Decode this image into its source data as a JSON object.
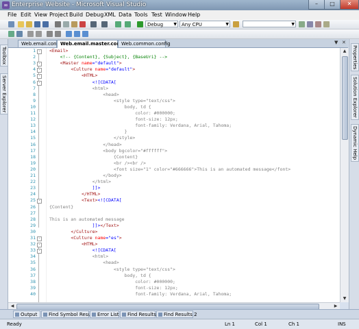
{
  "window": {
    "title": "Enterprise Website - Microsoft Visual Studio",
    "min": "–",
    "max": "□",
    "close": "✕"
  },
  "menu": [
    "File",
    "Edit",
    "View",
    "Project",
    "Build",
    "Debug",
    "XML",
    "Data",
    "Tools",
    "Test",
    "Window",
    "Help"
  ],
  "toolbar": {
    "config": "Debug",
    "platform": "Any CPU"
  },
  "side_left": [
    "Toolbox",
    "Server Explorer"
  ],
  "side_right": [
    "Properties",
    "Solution Explorer",
    "Dynamic Help"
  ],
  "tabs": [
    {
      "label": "Web.email.config",
      "active": false
    },
    {
      "label": "Web.email.master.config",
      "active": true
    },
    {
      "label": "Web.common.config",
      "active": false
    }
  ],
  "tab_controls": {
    "list": "▼",
    "close": "✕"
  },
  "code_lines": [
    {
      "n": "1",
      "fold": "-",
      "t": [
        [
          "tag",
          "<Email>"
        ]
      ]
    },
    {
      "n": "2",
      "t": [
        [
          "txt",
          "    "
        ],
        [
          "com",
          "<!-- {Content}, {Subject}, {BaseUri} -->"
        ]
      ]
    },
    {
      "n": "3",
      "fold": "-",
      "t": [
        [
          "txt",
          "    "
        ],
        [
          "tag",
          "<Master "
        ],
        [
          "att",
          "name"
        ],
        [
          "sym",
          "="
        ],
        [
          "val",
          "\"default\""
        ],
        [
          "tag",
          ">"
        ]
      ]
    },
    {
      "n": "4",
      "fold": "-",
      "t": [
        [
          "txt",
          "        "
        ],
        [
          "tag",
          "<Culture "
        ],
        [
          "att",
          "name"
        ],
        [
          "sym",
          "="
        ],
        [
          "val",
          "\"default\""
        ],
        [
          "tag",
          ">"
        ]
      ]
    },
    {
      "n": "5",
      "fold": "-",
      "t": [
        [
          "txt",
          "            "
        ],
        [
          "tag",
          "<HTML>"
        ]
      ]
    },
    {
      "n": "6",
      "fold": "-",
      "t": [
        [
          "txt",
          "                "
        ],
        [
          "sym",
          "<![CDATA["
        ]
      ]
    },
    {
      "n": "7",
      "t": [
        [
          "txt",
          "                "
        ],
        [
          "cdata",
          "<html>"
        ]
      ]
    },
    {
      "n": "8",
      "t": [
        [
          "txt",
          "                    "
        ],
        [
          "cdata",
          "<head>"
        ]
      ]
    },
    {
      "n": "9",
      "t": [
        [
          "txt",
          "                        "
        ],
        [
          "cdata",
          "<style type=\"text/css\">"
        ]
      ]
    },
    {
      "n": "10",
      "t": [
        [
          "txt",
          "                            "
        ],
        [
          "cdata",
          "body, td {"
        ]
      ]
    },
    {
      "n": "11",
      "t": [
        [
          "txt",
          "                                "
        ],
        [
          "cdata",
          "color: #000000;"
        ]
      ]
    },
    {
      "n": "12",
      "t": [
        [
          "txt",
          "                                "
        ],
        [
          "cdata",
          "font-size: 12px;"
        ]
      ]
    },
    {
      "n": "13",
      "t": [
        [
          "txt",
          "                                "
        ],
        [
          "cdata",
          "font-family: Verdana, Arial, Tahoma;"
        ]
      ]
    },
    {
      "n": "14",
      "t": [
        [
          "txt",
          "                            "
        ],
        [
          "cdata",
          "}"
        ]
      ]
    },
    {
      "n": "15",
      "t": [
        [
          "txt",
          "                        "
        ],
        [
          "cdata",
          "</style>"
        ]
      ]
    },
    {
      "n": "16",
      "t": [
        [
          "txt",
          "                    "
        ],
        [
          "cdata",
          "</head>"
        ]
      ]
    },
    {
      "n": "17",
      "t": [
        [
          "txt",
          "                    "
        ],
        [
          "cdata",
          "<body bgcolor=\"#ffffff\">"
        ]
      ]
    },
    {
      "n": "18",
      "t": [
        [
          "txt",
          "                        "
        ],
        [
          "cdata",
          "{Content}"
        ]
      ]
    },
    {
      "n": "19",
      "t": [
        [
          "txt",
          "                        "
        ],
        [
          "cdata",
          "<br /><br />"
        ]
      ]
    },
    {
      "n": "20",
      "t": [
        [
          "txt",
          "                        "
        ],
        [
          "cdata",
          "<font size=\"1\" color=\"#666666\">This is an automated message</font>"
        ]
      ]
    },
    {
      "n": "21",
      "t": [
        [
          "txt",
          "                    "
        ],
        [
          "cdata",
          "</body>"
        ]
      ]
    },
    {
      "n": "22",
      "t": [
        [
          "txt",
          "                "
        ],
        [
          "cdata",
          "</html>"
        ]
      ]
    },
    {
      "n": "23",
      "t": [
        [
          "txt",
          "                "
        ],
        [
          "sym",
          "]]>"
        ]
      ]
    },
    {
      "n": "24",
      "t": [
        [
          "txt",
          "            "
        ],
        [
          "tag",
          "</HTML>"
        ]
      ]
    },
    {
      "n": "25",
      "fold": "-",
      "t": [
        [
          "txt",
          "            "
        ],
        [
          "tag",
          "<Text>"
        ],
        [
          "sym",
          "<![CDATA["
        ]
      ]
    },
    {
      "n": "26",
      "t": [
        [
          "cdata",
          "{Content}"
        ]
      ]
    },
    {
      "n": "27",
      "t": [
        [
          "txt",
          ""
        ]
      ]
    },
    {
      "n": "28",
      "t": [
        [
          "cdata",
          "This is an automated message"
        ]
      ]
    },
    {
      "n": "29",
      "t": [
        [
          "txt",
          "                "
        ],
        [
          "sym",
          "]]>"
        ],
        [
          "tag",
          "</Text>"
        ]
      ]
    },
    {
      "n": "30",
      "t": [
        [
          "txt",
          "        "
        ],
        [
          "tag",
          "</Culture>"
        ]
      ]
    },
    {
      "n": "31",
      "fold": "-",
      "t": [
        [
          "txt",
          "        "
        ],
        [
          "tag",
          "<Culture "
        ],
        [
          "att",
          "name"
        ],
        [
          "sym",
          "="
        ],
        [
          "val",
          "\"es\""
        ],
        [
          "tag",
          ">"
        ]
      ]
    },
    {
      "n": "32",
      "fold": "-",
      "t": [
        [
          "txt",
          "            "
        ],
        [
          "tag",
          "<HTML>"
        ]
      ]
    },
    {
      "n": "33",
      "fold": "-",
      "t": [
        [
          "txt",
          "                "
        ],
        [
          "sym",
          "<![CDATA["
        ]
      ]
    },
    {
      "n": "34",
      "t": [
        [
          "txt",
          "                "
        ],
        [
          "cdata",
          "<html>"
        ]
      ]
    },
    {
      "n": "35",
      "t": [
        [
          "txt",
          "                    "
        ],
        [
          "cdata",
          "<head>"
        ]
      ]
    },
    {
      "n": "36",
      "t": [
        [
          "txt",
          "                        "
        ],
        [
          "cdata",
          "<style type=\"text/css\">"
        ]
      ]
    },
    {
      "n": "37",
      "t": [
        [
          "txt",
          "                            "
        ],
        [
          "cdata",
          "body, td {"
        ]
      ]
    },
    {
      "n": "38",
      "t": [
        [
          "txt",
          "                                "
        ],
        [
          "cdata",
          "color: #000000;"
        ]
      ]
    },
    {
      "n": "39",
      "t": [
        [
          "txt",
          "                                "
        ],
        [
          "cdata",
          "font-size: 12px;"
        ]
      ]
    },
    {
      "n": "40",
      "t": [
        [
          "txt",
          "                                "
        ],
        [
          "cdata",
          "font-family: Verdana, Arial, Tahoma;"
        ]
      ]
    }
  ],
  "bottom_tabs": [
    "Output",
    "Find Symbol Results",
    "Error List",
    "Find Results 1",
    "Find Results 2"
  ],
  "status": {
    "ready": "Ready",
    "ln": "Ln 1",
    "col": "Col 1",
    "ch": "Ch 1",
    "ins": "INS"
  }
}
